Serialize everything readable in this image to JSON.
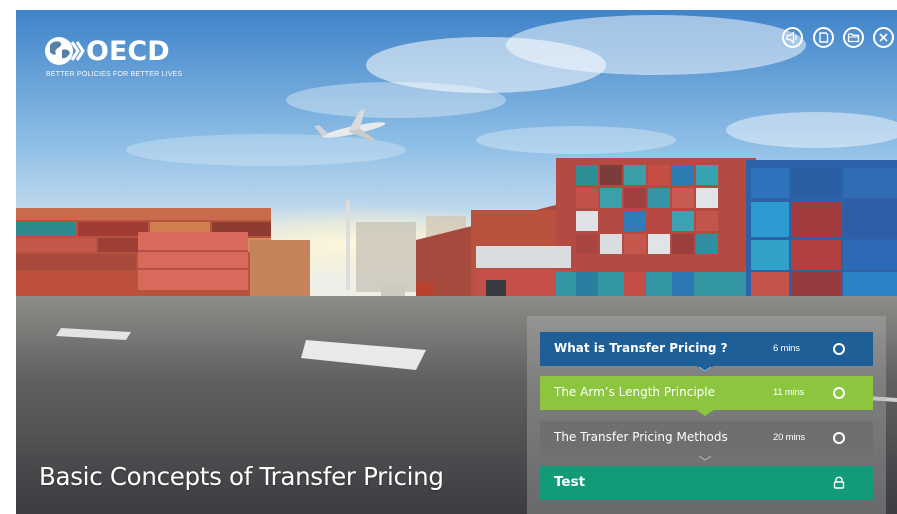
{
  "brand": {
    "name": "OECD",
    "tagline": "BETTER POLICIES FOR BETTER LIVES"
  },
  "controls": [
    {
      "name": "audio-icon"
    },
    {
      "name": "notes-icon"
    },
    {
      "name": "folder-icon"
    },
    {
      "name": "close-icon"
    }
  ],
  "course_title": "Basic Concepts of Transfer Pricing",
  "modules": [
    {
      "label": "What is Transfer Pricing ?",
      "duration": "6 mins",
      "status_icon": "circle-icon",
      "color": "#1d5f96"
    },
    {
      "label": "The Arm’s Length Principle",
      "duration": "11 mins",
      "status_icon": "circle-icon",
      "color": "#8cc63f"
    },
    {
      "label": "The Transfer Pricing Methods",
      "duration": "20 mins",
      "status_icon": "circle-icon",
      "color": "#706f6f"
    },
    {
      "label": "Test",
      "status_icon": "lock-icon",
      "color": "#139b79"
    }
  ]
}
